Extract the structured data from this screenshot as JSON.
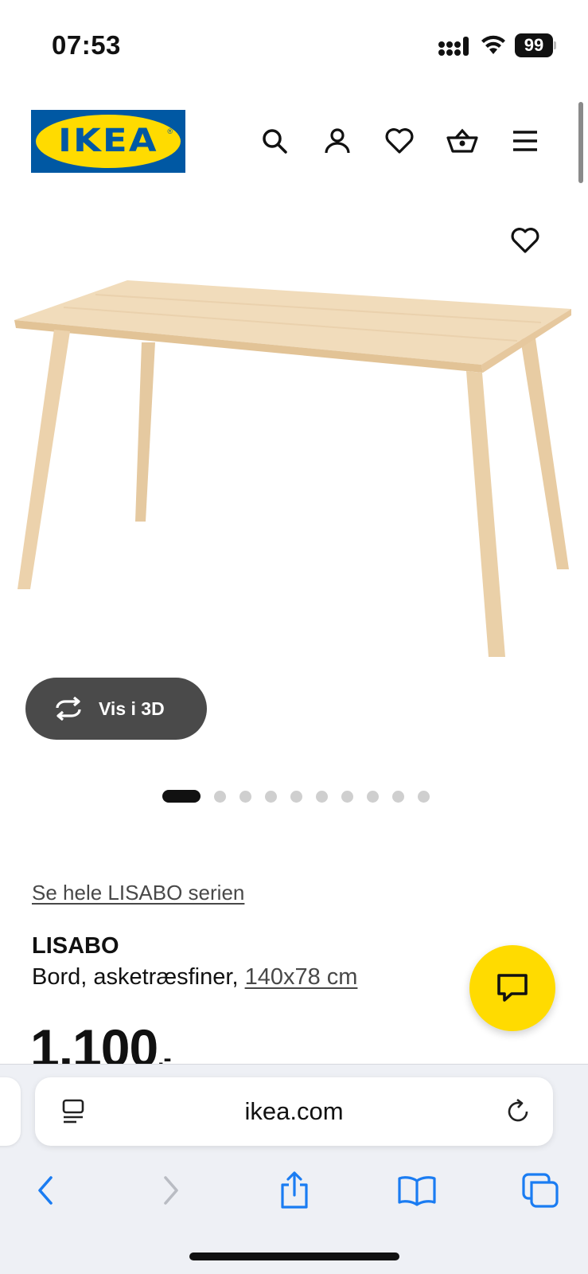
{
  "status_bar": {
    "time": "07:53",
    "battery": "99",
    "icons": [
      "signal-icon",
      "wifi-icon",
      "battery-icon"
    ]
  },
  "header": {
    "logo_text": "IKEA",
    "icons": [
      "search-icon",
      "account-icon",
      "heart-icon",
      "basket-icon",
      "menu-icon"
    ]
  },
  "gallery": {
    "view_3d_label": "Vis i 3D",
    "image_count": 10,
    "active_index": 0
  },
  "product": {
    "series_link": "Se hele LISABO serien",
    "name": "LISABO",
    "description": "Bord, asketræsfiner, ",
    "size": "140x78 cm",
    "price": "1.100",
    "price_suffix": ".-"
  },
  "browser": {
    "url": "ikea.com",
    "icons": [
      "reader-icon",
      "reload-icon",
      "back-icon",
      "forward-icon",
      "share-icon",
      "bookmarks-icon",
      "tabs-icon"
    ]
  },
  "colors": {
    "ikea_blue": "#0058a3",
    "ikea_yellow": "#ffdb00",
    "ios_blue": "#1a7cf2",
    "pill_dark": "#4a4a4a"
  }
}
